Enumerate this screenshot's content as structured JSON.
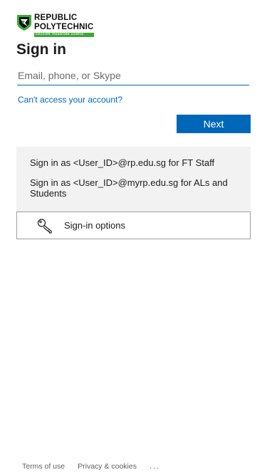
{
  "logo": {
    "line1": "REPUBLIC",
    "line2": "POLYTECHNIC",
    "tagline": "DISCOVER. TRANSFORM. ACHIEVE.",
    "shield_color": "#3aa935"
  },
  "signin": {
    "title": "Sign in",
    "email_placeholder": "Email, phone, or Skype",
    "email_value": "",
    "cant_access_link": "Can't access your account?",
    "next_label": "Next"
  },
  "info": {
    "staff_line": "Sign in as <User_ID>@rp.edu.sg for FT Staff",
    "student_line": "Sign in as <User_ID>@myrp.edu.sg for ALs and Students"
  },
  "options": {
    "label": "Sign-in options",
    "icon": "key-icon"
  },
  "footer": {
    "terms": "Terms of use",
    "privacy": "Privacy & cookies",
    "more": "..."
  },
  "colors": {
    "accent": "#0067b8",
    "panel": "#f2f2f2",
    "brand_green": "#3aa935"
  }
}
